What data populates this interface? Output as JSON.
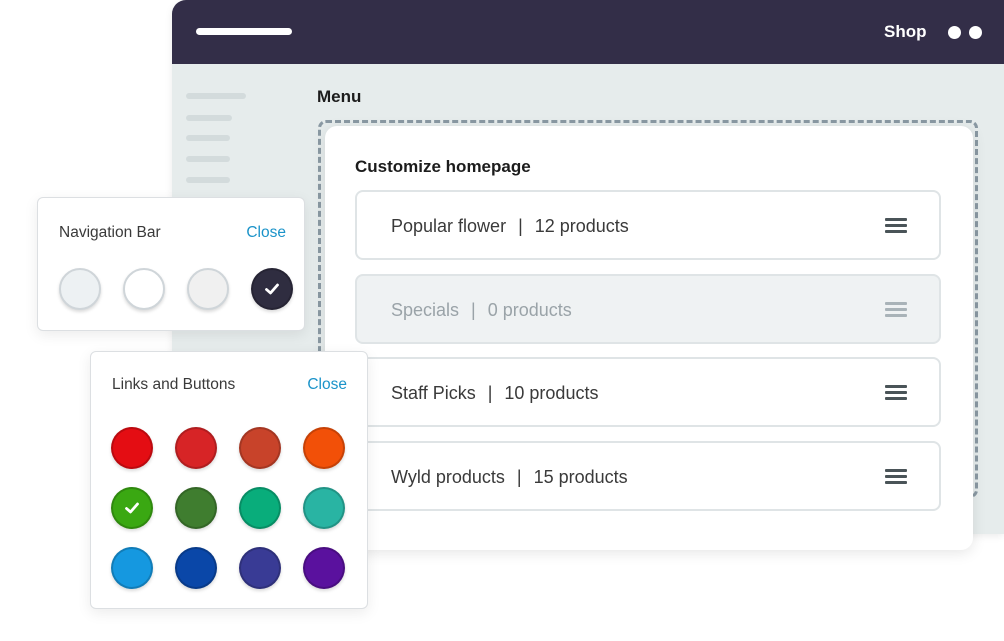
{
  "window": {
    "title": "Shop",
    "menu_label": "Menu"
  },
  "card": {
    "title": "Customize homepage",
    "rows": [
      {
        "name": "Popular flower",
        "count": "12 products",
        "disabled": false
      },
      {
        "name": "Specials",
        "count": "0 products",
        "disabled": true
      },
      {
        "name": "Staff Picks",
        "count": "10 products",
        "disabled": false
      },
      {
        "name": "Wyld products",
        "count": "15 products",
        "disabled": false
      }
    ],
    "separator": "|"
  },
  "nav_panel": {
    "title": "Navigation Bar",
    "close_label": "Close",
    "swatches": [
      "#edf1f3",
      "#ffffff",
      "#f0f0f0",
      "#2f2d40"
    ],
    "selected_index": 3
  },
  "links_panel": {
    "title": "Links and Buttons",
    "close_label": "Close",
    "swatches": [
      "#e40d13",
      "#d72426",
      "#c8432a",
      "#f25008",
      "#3aa812",
      "#3f7d2f",
      "#09ad7b",
      "#29b4a3",
      "#1598e0",
      "#0a47a8",
      "#393b95",
      "#5a119e"
    ],
    "selected_index": 4
  },
  "colors": {
    "titlebar": "#332e48",
    "link": "#1b93c9",
    "dashed_border": "#8a99a3"
  }
}
